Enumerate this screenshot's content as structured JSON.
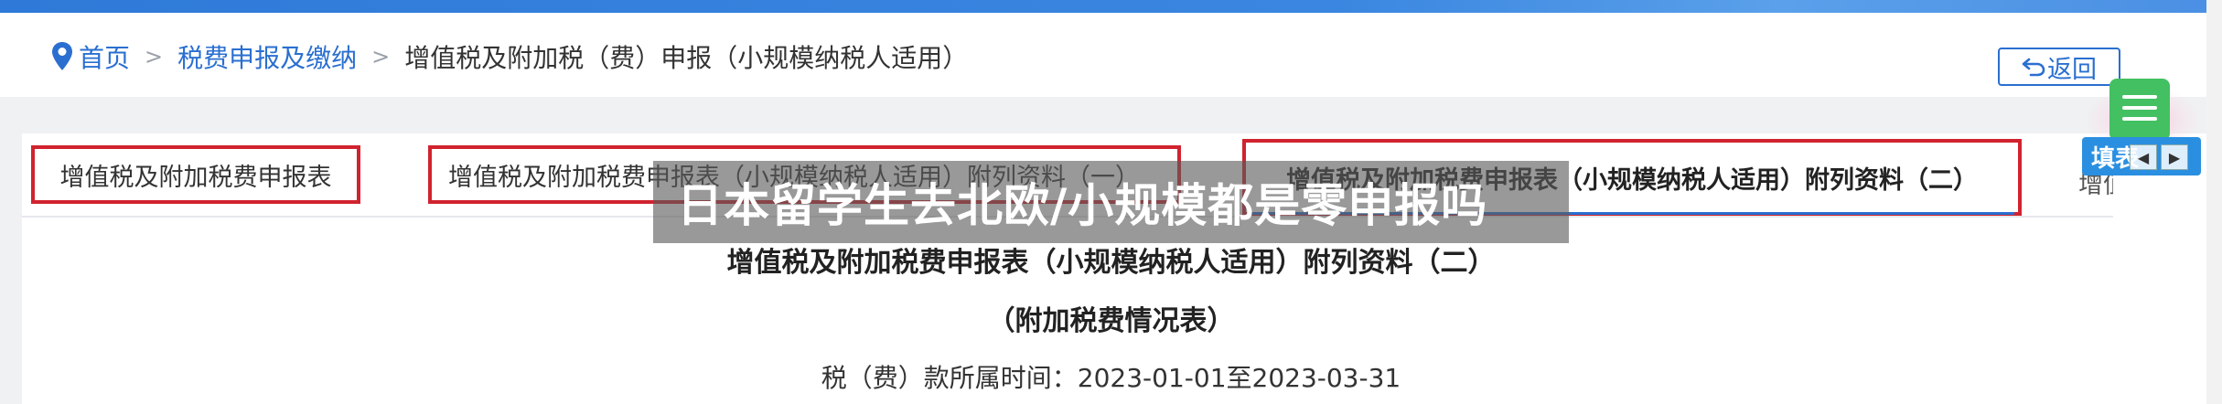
{
  "breadcrumb": {
    "home": "首页",
    "section": "税费申报及缴纳",
    "separator": ">",
    "current": "增值税及附加税（费）申报（小规模纳税人适用）"
  },
  "back_button": {
    "label": "返回"
  },
  "tabs": [
    {
      "label": "增值税及附加税费申报表"
    },
    {
      "label": "增值税及附加税费申报表（小规模纳税人适用）附列资料（一）"
    },
    {
      "label": "增值税及附加税费申报表（小规模纳税人适用）附列资料（二）",
      "active": true
    },
    {
      "label": "增值"
    }
  ],
  "form": {
    "title": "增值税及附加税费申报表（小规模纳税人适用）附列资料（二）",
    "subtitle": "（附加税费情况表）",
    "period_label": "税（费）款所属时间：",
    "period_value": "2023-01-01至2023-03-31"
  },
  "floating": {
    "fill_label": "填表"
  },
  "watermark": {
    "text": "日本留学生去北欧/小规模都是零申报吗"
  },
  "colors": {
    "link": "#2a6fd0",
    "highlight_border": "#d0232f",
    "top_band": "#3a86e0",
    "float_green": "#43c062",
    "float_blue": "#2a8fe0"
  },
  "icons": {
    "home": "location-pin-icon",
    "back": "return-arrow-icon",
    "float_menu": "menu-icon",
    "nav_prev": "arrow-left-icon",
    "nav_next": "arrow-right-icon"
  }
}
